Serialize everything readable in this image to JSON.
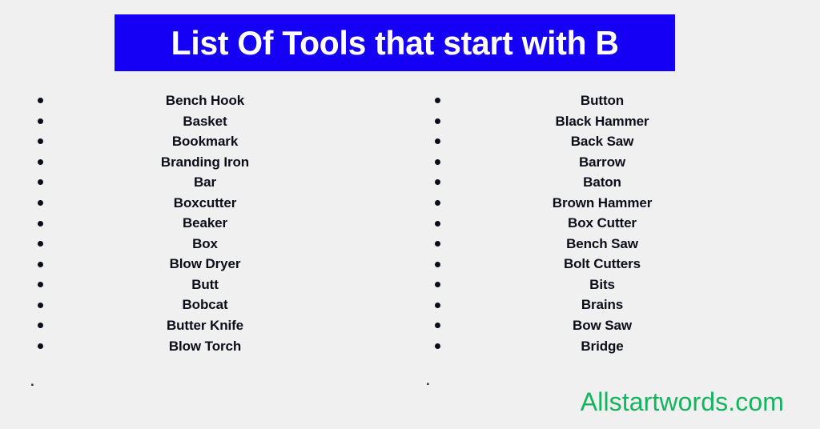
{
  "banner": {
    "title": "List Of Tools that start with B",
    "background_color": "#1500f5",
    "text_color": "#ffffff"
  },
  "page": {
    "background_color": "#f0f0f0",
    "text_color": "#0d0d1a"
  },
  "columns": [
    {
      "id": "left",
      "bullet": "•",
      "trailing_mark": ".",
      "items": [
        "Bench Hook",
        "Basket",
        "Bookmark",
        "Branding Iron",
        "Bar",
        "Boxcutter",
        "Beaker",
        "Box",
        "Blow Dryer",
        "Butt",
        "Bobcat",
        "Butter Knife",
        "Blow Torch"
      ]
    },
    {
      "id": "right",
      "bullet": "•",
      "trailing_mark": ".",
      "items": [
        "Button",
        "Black Hammer",
        "Back Saw",
        "Barrow",
        "Baton",
        "Brown Hammer",
        "Box Cutter",
        "Bench Saw",
        "Bolt Cutters",
        "Bits",
        "Brains",
        "Bow Saw",
        "Bridge"
      ]
    }
  ],
  "watermark": {
    "text": "Allstartwords.com",
    "color": "#14b45e"
  }
}
